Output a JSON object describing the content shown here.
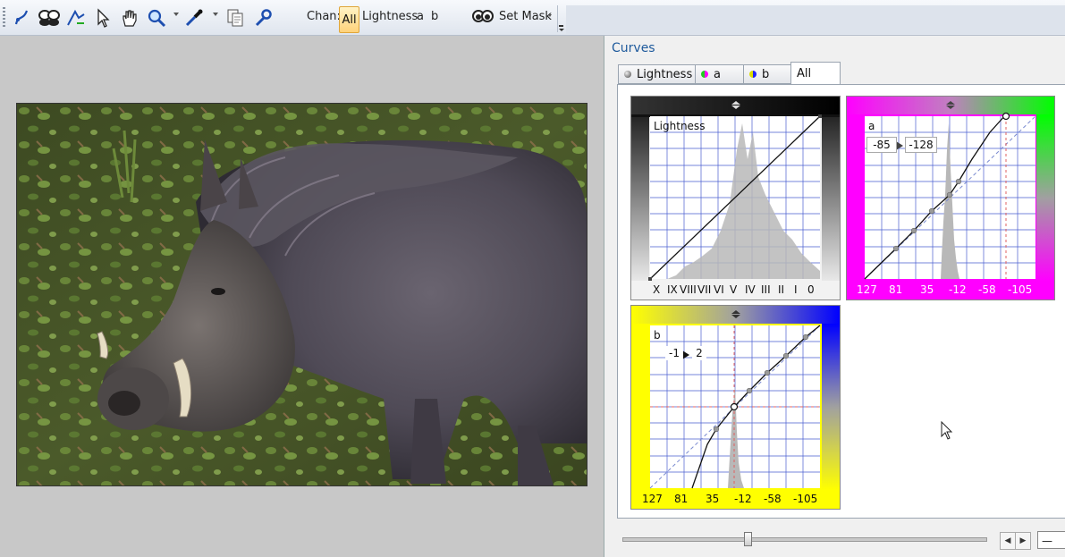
{
  "toolbar": {
    "chan_label": "Chan:",
    "chan_all": "All",
    "chan_lightness": "Lightness",
    "chan_a": "a",
    "chan_b": "b",
    "set_mask": "Set Mask"
  },
  "panel": {
    "title": "Curves",
    "tabs": [
      {
        "label": "Lightness"
      },
      {
        "label": "a"
      },
      {
        "label": "b"
      },
      {
        "label": "All"
      }
    ]
  },
  "graphs": {
    "lightness": {
      "title": "Lightness",
      "ticks": [
        "X",
        "IX",
        "VIII",
        "VII",
        "VI",
        "V",
        "IV",
        "III",
        "II",
        "I",
        "0"
      ]
    },
    "a": {
      "title": "a",
      "input": "-85",
      "output": "-128",
      "ticks": [
        "127",
        "81",
        "35",
        "-12",
        "-58",
        "-105"
      ]
    },
    "b": {
      "title": "b",
      "input": "-1",
      "output": "2",
      "ticks": [
        "127",
        "81",
        "35",
        "-12",
        "-58",
        "-105"
      ]
    }
  },
  "footer": {
    "field_value": "—"
  },
  "colors": {
    "accent_blue": "#1e5a9c",
    "grid": "#3a55c8",
    "a_magenta": "#ff00ff",
    "a_green": "#00ff00",
    "b_yellow": "#ffff00",
    "b_blue": "#0000ff"
  }
}
